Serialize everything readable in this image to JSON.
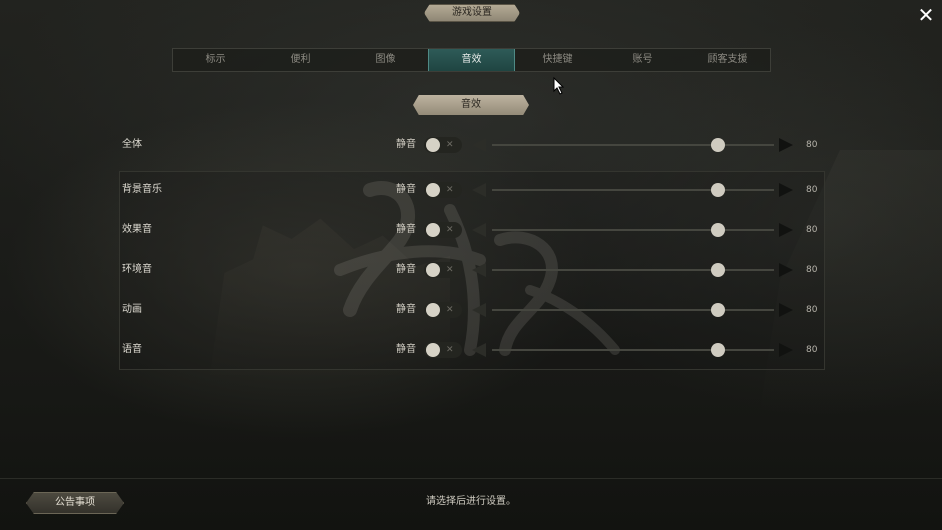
{
  "window": {
    "title": "游戏设置",
    "close_symbol": "✕"
  },
  "tabs": [
    {
      "label": "标示"
    },
    {
      "label": "便利"
    },
    {
      "label": "图像"
    },
    {
      "label": "音效",
      "active": true
    },
    {
      "label": "快捷键"
    },
    {
      "label": "账号"
    },
    {
      "label": "顾客支援"
    }
  ],
  "section": {
    "title": "音效"
  },
  "rows": [
    {
      "label": "全体",
      "mute_label": "静音",
      "muted": false,
      "value": "80",
      "level": 80
    },
    {
      "label": "背景音乐",
      "mute_label": "静音",
      "muted": false,
      "value": "80",
      "level": 80
    },
    {
      "label": "效果音",
      "mute_label": "静音",
      "muted": false,
      "value": "80",
      "level": 80
    },
    {
      "label": "环境音",
      "mute_label": "静音",
      "muted": false,
      "value": "80",
      "level": 80
    },
    {
      "label": "动画",
      "mute_label": "静音",
      "muted": false,
      "value": "80",
      "level": 80
    },
    {
      "label": "语音",
      "mute_label": "静音",
      "muted": false,
      "value": "80",
      "level": 80
    }
  ],
  "footer": {
    "notice_button": "公告事项",
    "hint": "请选择后进行设置。"
  },
  "colors": {
    "active_tab": "#2e5b58",
    "background": "#1c1d1a"
  },
  "icons": {
    "close": "close-icon",
    "toggle_off": "x-icon",
    "arrow_left": "arrow-left-icon",
    "arrow_right": "arrow-right-icon"
  }
}
